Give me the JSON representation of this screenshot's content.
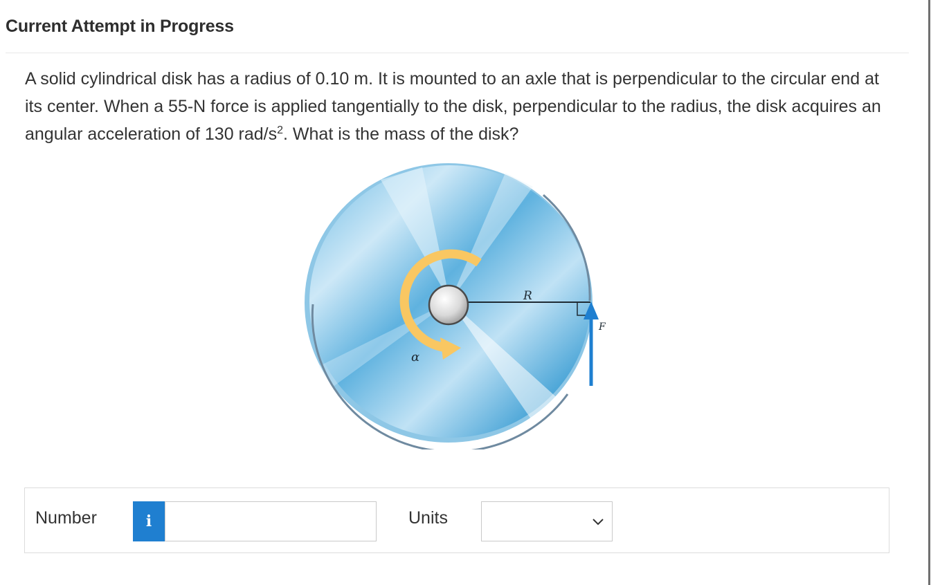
{
  "header": {
    "title": "Current Attempt in Progress"
  },
  "question": {
    "text_before_sup": "A solid cylindrical disk has a radius of 0.10 m. It is mounted to an axle that is perpendicular to the circular end at its center. When a 55-N force is applied tangentially to the disk, perpendicular to the radius, the disk acquires an angular acceleration of 130 rad/s",
    "sup": "2",
    "text_after_sup": ". What is the mass of the disk?"
  },
  "figure": {
    "radius_label": "R",
    "force_label": "F",
    "alpha_label": "α",
    "disk_color": "#55aedd",
    "arrow_color": "#1e7fd0",
    "alpha_arrow_color": "#f9c762"
  },
  "answer": {
    "number_label": "Number",
    "info_icon": "i",
    "number_value": "",
    "units_label": "Units",
    "units_selected": ""
  }
}
